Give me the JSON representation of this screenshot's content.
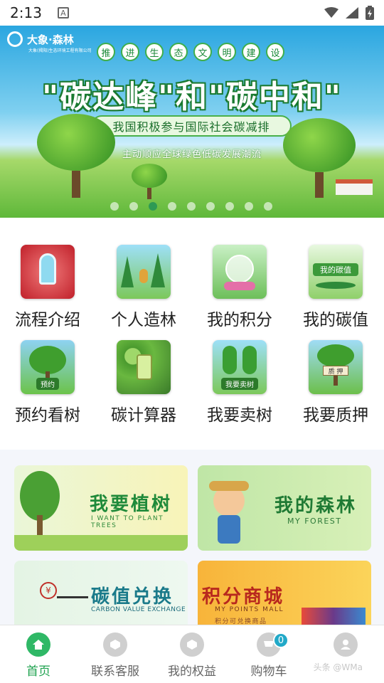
{
  "status_bar": {
    "time": "2:13",
    "notification_icon": "A"
  },
  "banner": {
    "brand": "大象·森林",
    "brand_sub": "大象(揭阳)生态环境工程有限公司",
    "slogan_chars": [
      "推",
      "进",
      "生",
      "态",
      "文",
      "明",
      "建",
      "设"
    ],
    "title": "\"碳达峰\"和\"碳中和\"",
    "pill": "我国积极参与国际社会碳减排",
    "subtitle": "主动顺应全球绿色低碳发展潮流",
    "dots_total": 9,
    "dots_active_index": 2
  },
  "menu": [
    {
      "label": "流程介绍",
      "icon": "phone-flow-icon"
    },
    {
      "label": "个人造林",
      "icon": "planting-person-icon"
    },
    {
      "label": "我的积分",
      "icon": "points-globe-icon"
    },
    {
      "label": "我的碳值",
      "icon": "carbon-value-icon",
      "tag": "我的碳值"
    },
    {
      "label": "预约看树",
      "icon": "tree-appointment-icon",
      "tag": "预约"
    },
    {
      "label": "碳计算器",
      "icon": "calculator-icon"
    },
    {
      "label": "我要卖树",
      "icon": "sell-tree-icon",
      "tag": "我要卖树"
    },
    {
      "label": "我要质押",
      "icon": "pledge-tree-icon",
      "tag": "质 押"
    }
  ],
  "cards": [
    {
      "title": "我要植树",
      "subtitle": "I WANT TO PLANT TREES"
    },
    {
      "title": "我的森林",
      "subtitle": "MY FOREST"
    },
    {
      "title": "碳值兑换",
      "subtitle": "CARBON VALUE EXCHANGE"
    },
    {
      "title": "积分商城",
      "subtitle": "MY POINTS MALL",
      "note": "积分可兑换商品"
    }
  ],
  "tabbar": {
    "items": [
      {
        "label": "首页",
        "icon": "home-icon",
        "active": true
      },
      {
        "label": "联系客服",
        "icon": "service-icon"
      },
      {
        "label": "我的权益",
        "icon": "rights-icon"
      },
      {
        "label": "购物车",
        "icon": "cart-icon",
        "badge": "0"
      },
      {
        "label": "",
        "icon": "profile-icon"
      }
    ],
    "watermark": "头条 @WMa"
  },
  "colors": {
    "brand_green": "#1fa24f",
    "badge": "#21a9c8"
  }
}
